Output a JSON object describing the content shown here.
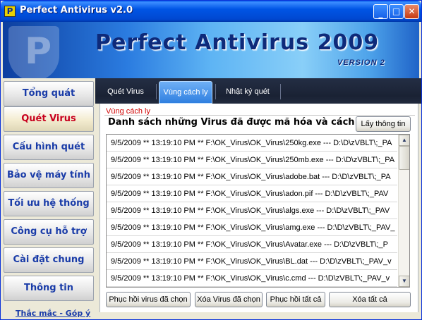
{
  "window": {
    "title": "Perfect Antivirus v2.0",
    "app_icon": "P",
    "controls": {
      "minimize_icon": "minimize-icon",
      "maximize_icon": "maximize-icon",
      "close_icon": "close-icon",
      "minimize_glyph": "_",
      "maximize_glyph": "□",
      "close_glyph": "✕"
    }
  },
  "banner": {
    "title": "Perfect Antivirus 2009",
    "version": "VERSION 2",
    "shield_letter": "P"
  },
  "sidebar": {
    "items": [
      {
        "label": "Tổng quát"
      },
      {
        "label": "Quét Virus",
        "active": true
      },
      {
        "label": "Cấu hình quét"
      },
      {
        "label": "Bảo vệ máy tính"
      },
      {
        "label": "Tối ưu hệ thống"
      },
      {
        "label": "Công cụ hỗ trợ"
      },
      {
        "label": "Cài đặt chung"
      },
      {
        "label": "Thông tin"
      }
    ],
    "footer_link": "Thắc mắc - Góp ý"
  },
  "tabs": [
    {
      "label": "Quét Virus"
    },
    {
      "label": "Vùng cách ly",
      "active": true
    },
    {
      "label": "Nhật ký quét"
    }
  ],
  "quarantine": {
    "section_title": "Vùng cách ly",
    "description": "Danh sách những Virus đã được mã hóa và cách ly",
    "info_button": "Lấy thông tin",
    "rows": [
      "9/5/2009  **  13:19:10 PM  **  F:\\OK_Virus\\OK_Virus\\250kg.exe --- D:\\D\\zVBLT\\;_PA",
      "9/5/2009  **  13:19:10 PM  **  F:\\OK_Virus\\OK_Virus\\250mb.exe --- D:\\D\\zVBLT\\;_PA",
      "9/5/2009  **  13:19:10 PM  **  F:\\OK_Virus\\OK_Virus\\adobe.bat --- D:\\D\\zVBLT\\;_PA",
      "9/5/2009  **  13:19:10 PM  **  F:\\OK_Virus\\OK_Virus\\adon.pif --- D:\\D\\zVBLT\\;_PAV",
      "9/5/2009  **  13:19:10 PM  **  F:\\OK_Virus\\OK_Virus\\algs.exe --- D:\\D\\zVBLT\\;_PAV",
      "9/5/2009  **  13:19:10 PM  **  F:\\OK_Virus\\OK_Virus\\amg.exe --- D:\\D\\zVBLT\\;_PAV_",
      "9/5/2009  **  13:19:10 PM  **  F:\\OK_Virus\\OK_Virus\\Avatar.exe --- D:\\D\\zVBLT\\;_P",
      "9/5/2009  **  13:19:10 PM  **  F:\\OK_Virus\\OK_Virus\\BL.dat --- D:\\D\\zVBLT\\;_PAV_v",
      "9/5/2009  **  13:19:10 PM  **  F:\\OK_Virus\\OK_Virus\\c.cmd --- D:\\D\\zVBLT\\;_PAV_v"
    ],
    "scroll_up_glyph": "▲",
    "scroll_down_glyph": "▼",
    "actions": {
      "restore_selected": "Phục hồi virus đã chọn",
      "delete_selected": "Xóa Virus đã chọn",
      "restore_all": "Phục hồi tất cả",
      "delete_all": "Xóa tất cả"
    }
  }
}
